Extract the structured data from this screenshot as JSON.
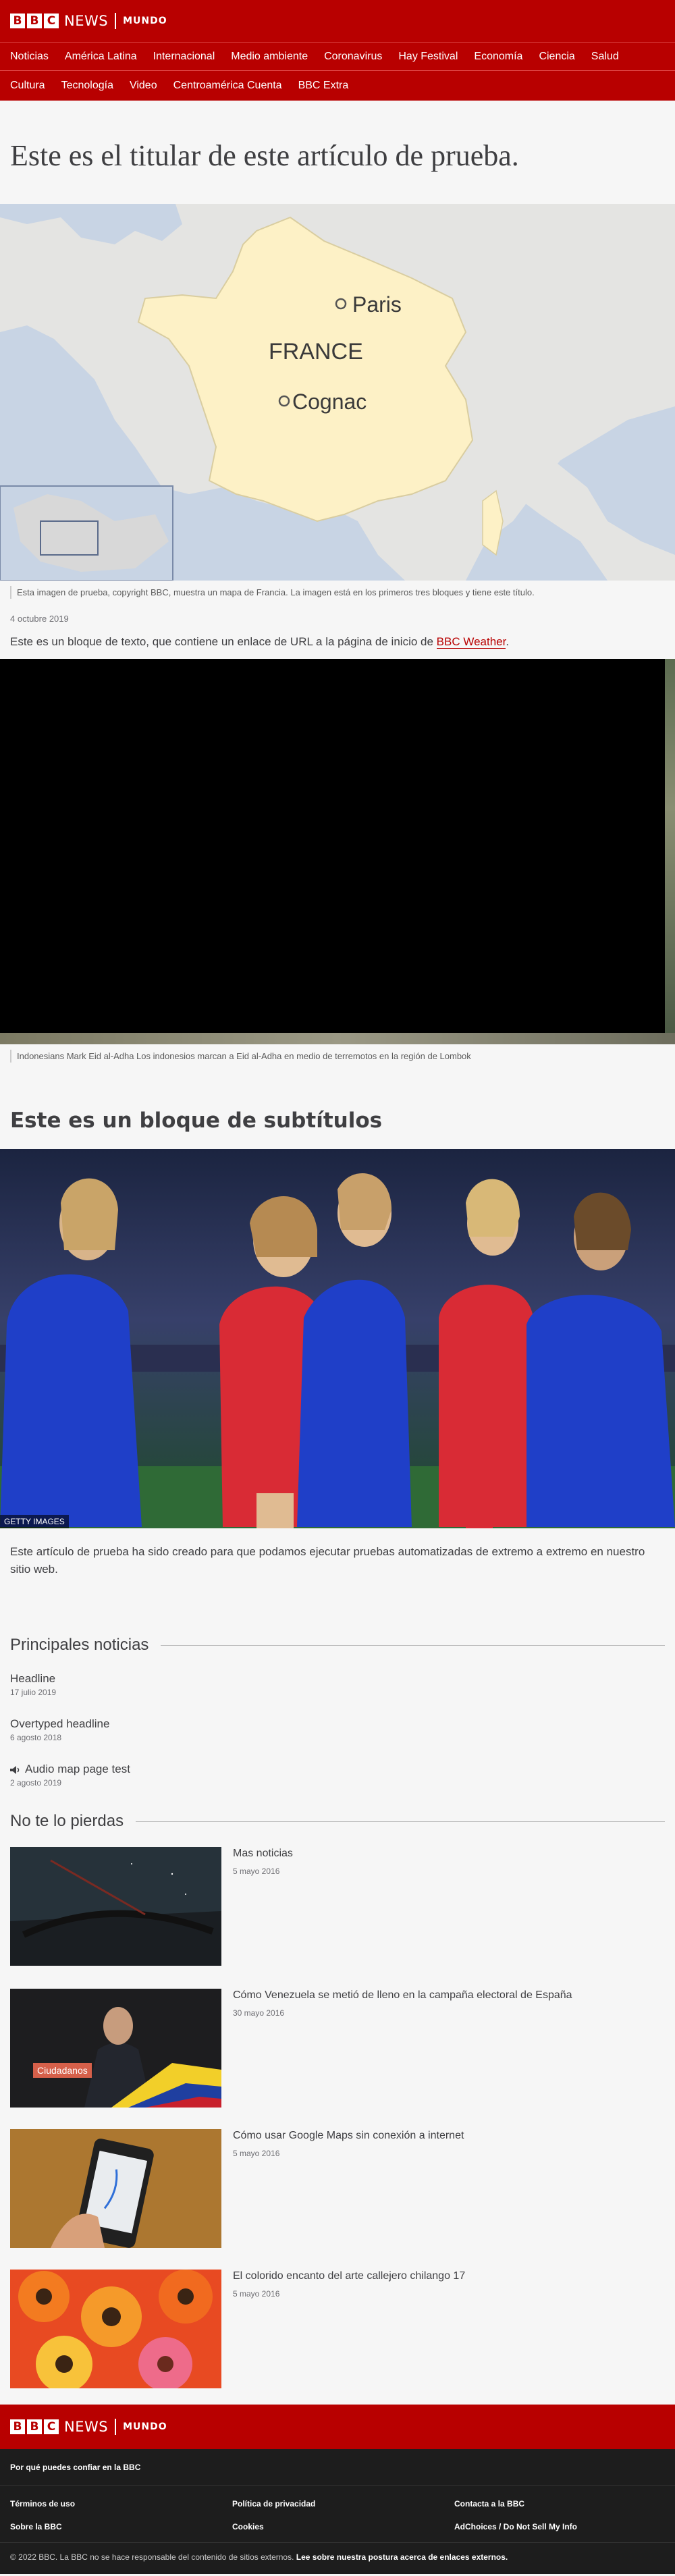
{
  "brand": {
    "letters": [
      "B",
      "B",
      "C"
    ],
    "news": "NEWS",
    "service": "MUNDO"
  },
  "nav": {
    "row1": [
      "Noticias",
      "América Latina",
      "Internacional",
      "Medio ambiente",
      "Coronavirus",
      "Hay Festival",
      "Economía",
      "Ciencia",
      "Salud"
    ],
    "row2": [
      "Cultura",
      "Tecnología",
      "Video",
      "Centroamérica Cuenta",
      "BBC Extra"
    ]
  },
  "article": {
    "headline": "Este es el titular de este artículo de prueba.",
    "map": {
      "country": "FRANCE",
      "city1": "Paris",
      "city2": "Cognac"
    },
    "map_caption": "Esta imagen de prueba, copyright BBC, muestra un mapa de Francia. La imagen está en los primeros tres bloques y tiene este título.",
    "date": "4 octubre 2019",
    "paragraph_before": "Este es un bloque de texto, que contiene un enlace de URL a la página de inicio de",
    "paragraph_link": "BBC Weather",
    "paragraph_after": ".",
    "video_caption": "Indonesians Mark Eid al-Adha Los indonesios marcan a Eid al-Adha en medio de terremotos en la región de Lombok",
    "subtitle": "Este es un bloque de subtítulos",
    "photo_credit": "GETTY IMAGES",
    "paragraph2": "Este artículo de prueba ha sido creado para que podamos ejecutar pruebas automatizadas de extremo a extremo en nuestro sitio web."
  },
  "top_stories": {
    "title": "Principales noticias",
    "items": [
      {
        "title": "Headline",
        "date": "17 julio 2019",
        "icon": ""
      },
      {
        "title": "Overtyped headline",
        "date": "6 agosto 2018",
        "icon": ""
      },
      {
        "title": "Audio map page test",
        "date": "2 agosto 2019",
        "icon": "audio-icon"
      }
    ]
  },
  "features": {
    "title": "No te lo pierdas",
    "items": [
      {
        "title": "Mas noticias",
        "date": "5 mayo 2016"
      },
      {
        "title": "Cómo Venezuela se metió de lleno en la campaña electoral de España",
        "date": "30 mayo 2016",
        "sign": "Ciudadanos"
      },
      {
        "title": "Cómo usar Google Maps sin conexión a internet",
        "date": "5 mayo 2016"
      },
      {
        "title": "El colorido encanto del arte callejero chilango 17",
        "date": "5 mayo 2016"
      }
    ]
  },
  "footer": {
    "trust": "Por qué puedes confiar en la BBC",
    "links": [
      "Términos de uso",
      "Política de privacidad",
      "Contacta a la BBC",
      "Sobre la BBC",
      "Cookies",
      "AdChoices / Do Not Sell My Info"
    ],
    "copyright": "© 2022 BBC. La BBC no se hace responsable del contenido de sitios externos.",
    "external_policy": "Lee sobre nuestra postura acerca de enlaces externos."
  },
  "colors": {
    "brand_red": "#b80000",
    "footer_bg": "#1d1d1d",
    "link": "#b80000"
  }
}
